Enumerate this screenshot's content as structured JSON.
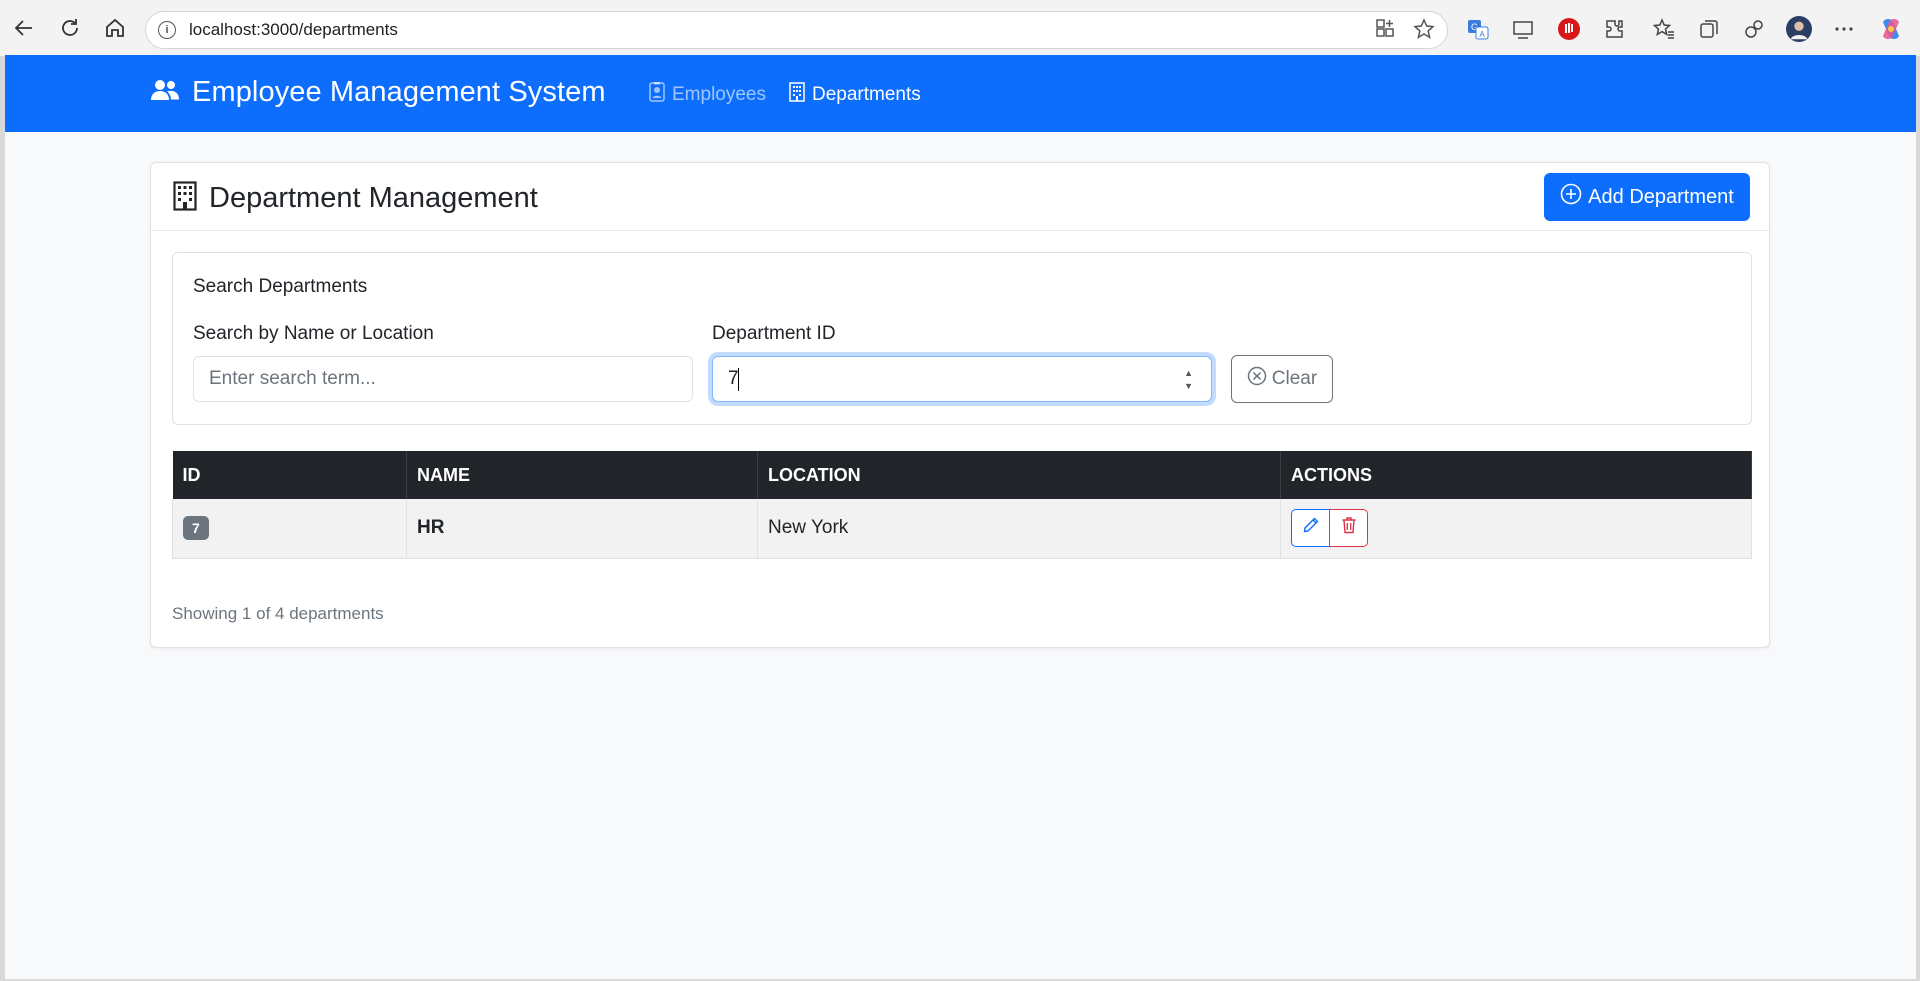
{
  "browser": {
    "url": "localhost:3000/departments"
  },
  "navbar": {
    "brand": "Employee Management System",
    "links": [
      {
        "label": "Employees",
        "active": false
      },
      {
        "label": "Departments",
        "active": true
      }
    ]
  },
  "page": {
    "title": "Department Management",
    "add_button": "Add Department"
  },
  "search": {
    "title": "Search Departments",
    "name_label": "Search by Name or Location",
    "name_placeholder": "Enter search term...",
    "name_value": "",
    "id_label": "Department ID",
    "id_value": "7",
    "clear_button": "Clear"
  },
  "table": {
    "columns": [
      "ID",
      "NAME",
      "LOCATION",
      "ACTIONS"
    ],
    "rows": [
      {
        "id": "7",
        "name": "HR",
        "location": "New York"
      }
    ]
  },
  "footer": {
    "showing": "Showing 1 of 4 departments"
  },
  "colors": {
    "primary": "#0d6efd",
    "danger": "#dc3545",
    "secondary": "#6c757d",
    "dark": "#212529"
  }
}
